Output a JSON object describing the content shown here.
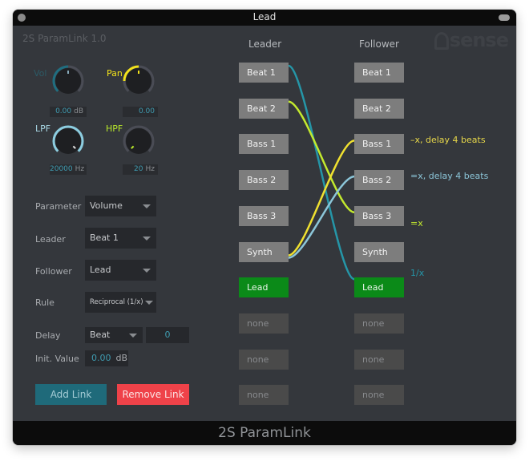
{
  "window": {
    "title": "Lead"
  },
  "header": {
    "app_version": "2S ParamLink  1.0",
    "logo": "sense",
    "leader_header": "Leader",
    "follower_header": "Follower"
  },
  "knobs": [
    {
      "id": "vol",
      "label": "Vol",
      "value": "0.00",
      "unit": "dB",
      "color": "#1f6e80",
      "label_color": "#2c5a66"
    },
    {
      "id": "pan",
      "label": "Pan",
      "value": "0.00",
      "unit": "",
      "color": "#f2e21b",
      "label_color": "#f2e21b"
    },
    {
      "id": "lpf",
      "label": "LPF",
      "value": "20000",
      "unit": "Hz",
      "color": "#8ccde0",
      "label_color": "#a9d8e6"
    },
    {
      "id": "hpf",
      "label": "HPF",
      "value": "20",
      "unit": "Hz",
      "color": "#b9e82b",
      "label_color": "#b9e82b"
    }
  ],
  "form": {
    "parameter": {
      "label": "Parameter",
      "value": "Volume"
    },
    "leader": {
      "label": "Leader",
      "value": "Beat 1"
    },
    "follower": {
      "label": "Follower",
      "value": "Lead"
    },
    "rule": {
      "label": "Rule",
      "value": "Reciprocal (1/x)"
    },
    "delay": {
      "label": "Delay",
      "mode": "Beat",
      "amount": "0"
    },
    "init_value": {
      "label": "Init. Value",
      "value": "0.00",
      "unit": "dB"
    },
    "add_link": "Add Link",
    "remove_link": "Remove Link"
  },
  "leaders": [
    {
      "name": "Beat 1",
      "state": "track"
    },
    {
      "name": "Beat 2",
      "state": "track"
    },
    {
      "name": "Bass 1",
      "state": "track"
    },
    {
      "name": "Bass 2",
      "state": "track"
    },
    {
      "name": "Bass 3",
      "state": "track"
    },
    {
      "name": "Synth",
      "state": "track"
    },
    {
      "name": "Lead",
      "state": "active"
    },
    {
      "name": "none",
      "state": "empty"
    },
    {
      "name": "none",
      "state": "empty"
    },
    {
      "name": "none",
      "state": "empty"
    }
  ],
  "followers": [
    {
      "name": "Beat 1",
      "state": "track"
    },
    {
      "name": "Beat 2",
      "state": "track"
    },
    {
      "name": "Bass 1",
      "state": "track"
    },
    {
      "name": "Bass 2",
      "state": "track"
    },
    {
      "name": "Bass 3",
      "state": "track"
    },
    {
      "name": "Synth",
      "state": "track"
    },
    {
      "name": "Lead",
      "state": "active"
    },
    {
      "name": "none",
      "state": "empty"
    },
    {
      "name": "none",
      "state": "empty"
    },
    {
      "name": "none",
      "state": "empty"
    }
  ],
  "links": [
    {
      "from": 0,
      "to": 6,
      "rule_text": "1/x",
      "color": "#2596a8"
    },
    {
      "from": 1,
      "to": 4,
      "rule_text": "=x",
      "color": "#c3ea2e"
    },
    {
      "from": 5,
      "to": 2,
      "rule_text": "–x, delay 4 beats",
      "color": "#f0e130"
    },
    {
      "from": 5,
      "to": 3,
      "rule_text": "=x, delay 4 beats",
      "color": "#8cc6d9"
    }
  ],
  "footer": {
    "title": "2S ParamLink"
  }
}
